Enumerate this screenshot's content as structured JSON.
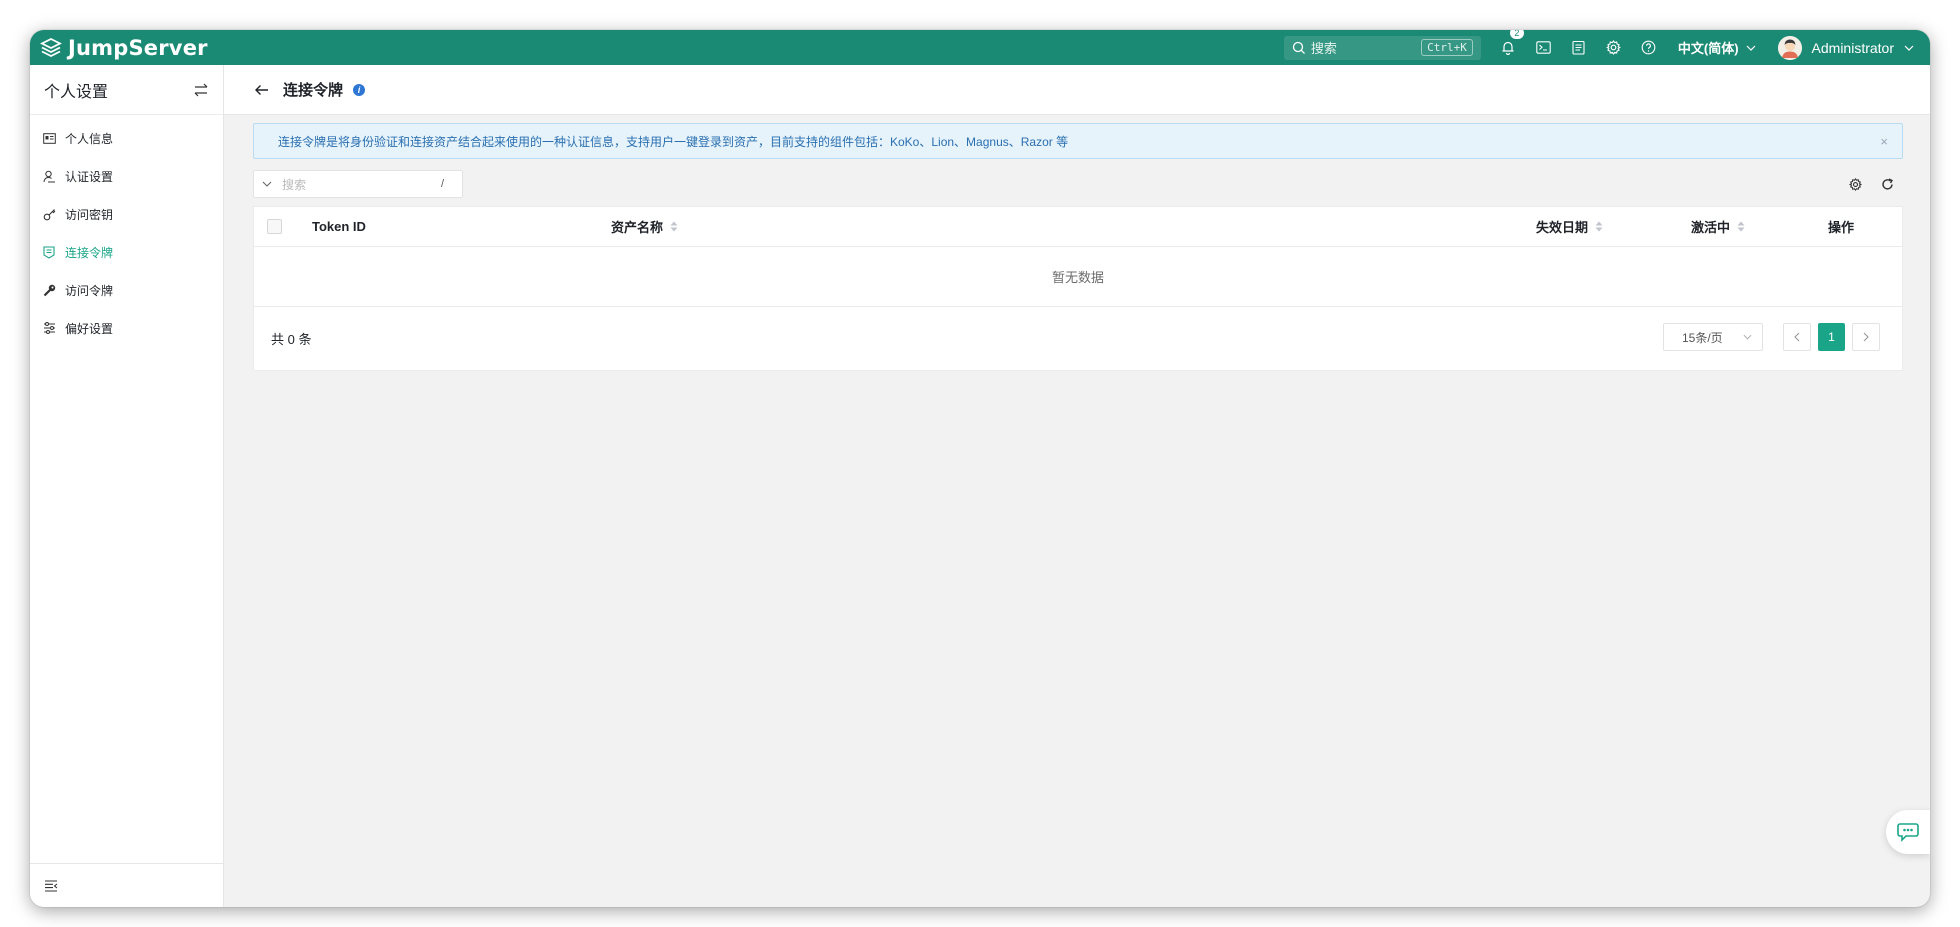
{
  "app": {
    "brand": "JumpServer"
  },
  "topbar": {
    "search_placeholder": "搜索",
    "search_shortcut": "Ctrl+K",
    "notification_count": "2",
    "language": "中文(简体)",
    "username": "Administrator",
    "icons": [
      "bell-icon",
      "terminal-icon",
      "clipboard-icon",
      "gear-icon",
      "help-icon"
    ]
  },
  "sidebar": {
    "title": "个人设置",
    "items": [
      {
        "label": "个人信息",
        "icon": "id-card-icon",
        "active": false
      },
      {
        "label": "认证设置",
        "icon": "user-lock-icon",
        "active": false
      },
      {
        "label": "访问密钥",
        "icon": "key-icon",
        "active": false
      },
      {
        "label": "连接令牌",
        "icon": "token-icon",
        "active": true
      },
      {
        "label": "访问令牌",
        "icon": "wrench-key-icon",
        "active": false
      },
      {
        "label": "偏好设置",
        "icon": "sliders-icon",
        "active": false
      }
    ]
  },
  "page": {
    "title": "连接令牌",
    "info_badge": "i",
    "alert": "连接令牌是将身份验证和连接资产结合起来使用的一种认证信息，支持用户一键登录到资产，目前支持的组件包括：KoKo、Lion、Magnus、Razor 等",
    "alert_close": "×"
  },
  "toolbar": {
    "search_placeholder": "搜索",
    "search_shortcut": "/"
  },
  "table": {
    "columns": [
      "Token ID",
      "资产名称",
      "失效日期",
      "激活中",
      "操作"
    ],
    "empty_text": "暂无数据",
    "total": "共 0 条",
    "page_size": "15条/页",
    "current_page": "1"
  },
  "colors": {
    "brand": "#1b8a74",
    "accent": "#1aa589",
    "alert_text": "#2a6fb0"
  }
}
